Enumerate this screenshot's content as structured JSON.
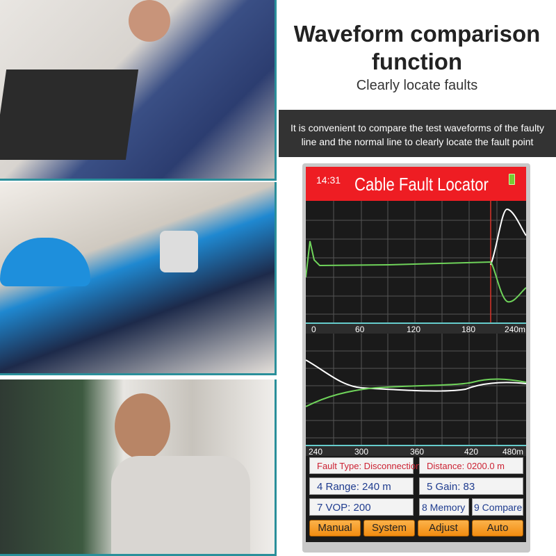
{
  "headline": {
    "line1": "Waveform comparison",
    "line2": "function",
    "subtitle": "Clearly locate faults"
  },
  "banner": "It is convenient to compare the test waveforms of the faulty line and the normal line to clearly locate the fault point",
  "device": {
    "time": "14:31",
    "title": "Cable Fault Locator",
    "battery_icon": "battery-full-icon",
    "chart1_axis": [
      "0",
      "60",
      "120",
      "180",
      "240m"
    ],
    "chart2_axis": [
      "240",
      "300",
      "360",
      "420",
      "480m"
    ],
    "fault_type": "Fault Type: Disconnection",
    "distance": "Distance: 0200.0 m",
    "range": "4 Range: 240 m",
    "gain": "5 Gain: 83",
    "vop": "7  VOP: 200",
    "memory": "8 Memory",
    "compare": "9 Compare",
    "buttons": [
      "Manual",
      "System",
      "Adjust",
      "Auto"
    ],
    "colors": {
      "header": "#ee1d23",
      "fault_wave": "#6fd35a",
      "normal_wave": "#ffffff",
      "cursor": "#d9342b",
      "button": "#f7a12a"
    }
  }
}
